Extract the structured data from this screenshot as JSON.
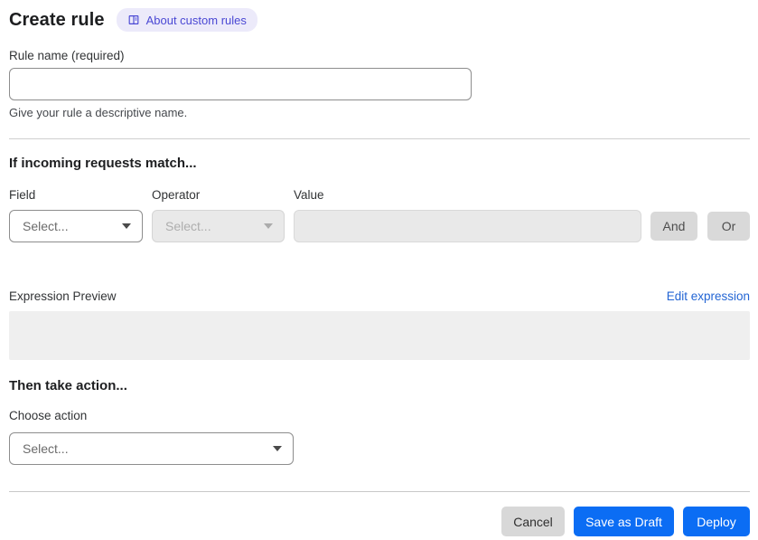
{
  "header": {
    "title": "Create rule",
    "badge_label": "About custom rules"
  },
  "rule_name": {
    "label": "Rule name (required)",
    "value": "",
    "helper": "Give your rule a descriptive name."
  },
  "match": {
    "heading": "If incoming requests match...",
    "field_label": "Field",
    "operator_label": "Operator",
    "value_label": "Value",
    "field_value": "Select...",
    "operator_value": "Select...",
    "value_value": "",
    "and_label": "And",
    "or_label": "Or"
  },
  "expression": {
    "label": "Expression Preview",
    "edit_link": "Edit expression",
    "content": ""
  },
  "action": {
    "heading": "Then take action...",
    "label": "Choose action",
    "select_value": "Select..."
  },
  "footer": {
    "cancel_label": "Cancel",
    "save_draft_label": "Save as Draft",
    "deploy_label": "Deploy"
  },
  "icons": {
    "badge": "book-icon",
    "select_caret": "chevron-down-icon"
  },
  "colors": {
    "primary_blue": "#0b6df4",
    "link_blue": "#2365d4",
    "badge_bg": "#eceafa",
    "badge_text": "#4a48d4",
    "disabled_bg": "#e9e9e9",
    "gray_button_bg": "#d9d9d9"
  }
}
